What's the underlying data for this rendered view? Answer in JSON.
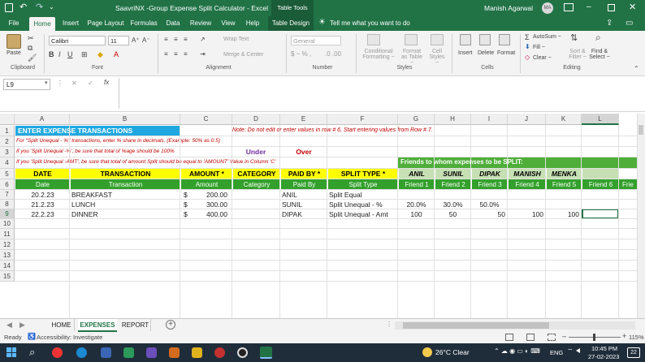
{
  "titlebar": {
    "doc_title": "SaavriNX -Group Expense Split Calculator  -  Excel",
    "context_tab": "Table Tools",
    "user_name": "Manish Agarwal",
    "user_initials": "MA"
  },
  "ribbon_tabs": [
    "File",
    "Home",
    "Insert",
    "Page Layout",
    "Formulas",
    "Data",
    "Review",
    "View",
    "Help",
    "Table Design"
  ],
  "tell_me": "Tell me what you want to do",
  "ribbon": {
    "paste": "Paste",
    "font_name": "Calibri",
    "font_size": "11",
    "wrap_text": "Wrap Text",
    "merge_center": "Merge & Center",
    "number_format": "General",
    "conditional_formatting": "Conditional Formatting ~",
    "format_as_table": "Format as Table ~",
    "cell_styles": "Cell Styles ~",
    "insert": "Insert",
    "delete": "Delete",
    "format": "Format",
    "autosum": "AutoSum ~",
    "fill": "Fill ~",
    "clear": "Clear ~",
    "sort_filter": "Sort & Filter ~",
    "find_select": "Find & Select ~",
    "groups": [
      "Clipboard",
      "Font",
      "Alignment",
      "Number",
      "Styles",
      "Cells",
      "Editing"
    ]
  },
  "formula_bar": {
    "name_box": "L9",
    "fx": "fx",
    "formula": ""
  },
  "columns": [
    "A",
    "B",
    "C",
    "D",
    "E",
    "F",
    "G",
    "H",
    "I",
    "J",
    "K",
    "L"
  ],
  "rows": [
    "1",
    "2",
    "3",
    "4",
    "5",
    "6",
    "7",
    "8",
    "9",
    "10",
    "11",
    "12",
    "13",
    "14",
    "15"
  ],
  "sheet": {
    "title": "ENTER EXPENSE TRANSACTIONS",
    "note": "Note: Do not edit or enter values in row # 6, Start entering values from Row # 7.",
    "instr1": "For \"Split Unequal - %\" transactions, enter % share in decimals. (Example: 50% as 0.5)",
    "instr2": "If you 'Split Unequal -%', be sure that total of %age should be 100%",
    "under": "Under",
    "over": "Over",
    "instr3": "If you 'Split Unequal -AMT', be sure that total of amount Split should be equal to 'AMOUNT' Value in Column 'C'",
    "friends_banner": "Friends to whom expenses to be SPLIT:",
    "headers": [
      "DATE",
      "TRANSACTION",
      "AMOUNT *",
      "CATEGORY",
      "PAID BY *",
      "SPLIT TYPE *"
    ],
    "friend_names": [
      "ANIL",
      "SUNIL",
      "DIPAK",
      "MANISH",
      "MENKA"
    ],
    "subheaders": [
      "Date",
      "Transaction",
      "Amount",
      "Category",
      "Paid By",
      "Split Type"
    ],
    "friend_cols": [
      "Friend 1",
      "Friend 2",
      "Friend 3",
      "Friend 4",
      "Friend 5",
      "Friend 6",
      "Frie"
    ],
    "data_rows": [
      {
        "date": "20.2.23",
        "txn": "BREAKFAST",
        "cur": "$",
        "amount": "200.00",
        "cat": "",
        "paid": "ANIL",
        "split": "Split Equal",
        "f": [
          "",
          "",
          "",
          "",
          ""
        ]
      },
      {
        "date": "21.2.23",
        "txn": "LUNCH",
        "cur": "$",
        "amount": "300.00",
        "cat": "",
        "paid": "SUNIL",
        "split": "Split Unequal - %",
        "f": [
          "20.0%",
          "30.0%",
          "50.0%",
          "",
          ""
        ]
      },
      {
        "date": "22.2.23",
        "txn": "DINNER",
        "cur": "$",
        "amount": "400.00",
        "cat": "",
        "paid": "DIPAK",
        "split": "Split Unequal - Amt",
        "f": [
          "100",
          "50",
          "50",
          "100",
          "100"
        ]
      }
    ]
  },
  "sheet_tabs": [
    "HOME",
    "EXPENSES",
    "REPORT"
  ],
  "statusbar": {
    "ready": "Ready",
    "accessibility": "Accessibility: Investigate",
    "zoom": "115%"
  },
  "taskbar": {
    "weather": "26°C  Clear",
    "lang": "ENG",
    "time": "10:45 PM",
    "date": "27-02-2023",
    "notif": "22"
  },
  "colors": {
    "excel_green": "#217346",
    "header_yellow": "#ffff00",
    "subheader_green": "#33a02c",
    "title_blue": "#1fa8e0",
    "note_red": "#c00000",
    "under_purple": "#7030a0",
    "banner_green": "#4fae3a"
  }
}
